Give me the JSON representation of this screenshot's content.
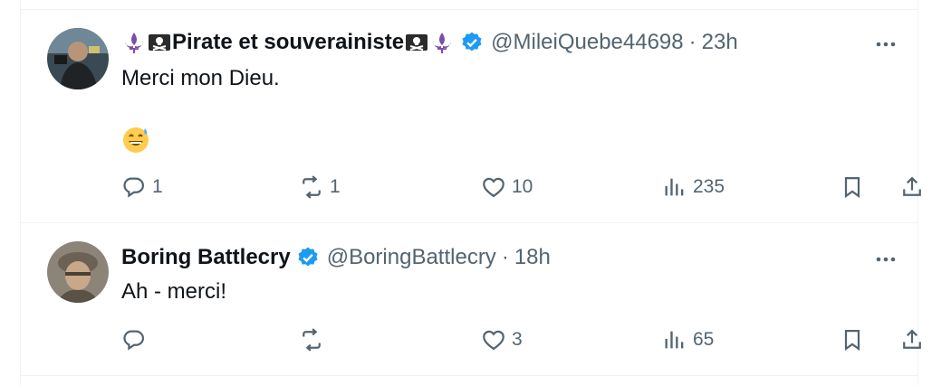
{
  "tweets": [
    {
      "display_name": "Pirate et souverainiste",
      "name_emoji": [
        "fleur-de-lis-emoji",
        "pirate-flag-emoji"
      ],
      "verified": true,
      "handle": "@MileiQuebe44698",
      "separator": "·",
      "time": "23h",
      "text_line1": "Merci mon Dieu.",
      "text_emoji": "grinning-sweat-emoji",
      "actions": {
        "replies": "1",
        "reposts": "1",
        "likes": "10",
        "views": "235"
      }
    },
    {
      "display_name": "Boring Battlecry",
      "verified": true,
      "handle": "@BoringBattlecry",
      "separator": "·",
      "time": "18h",
      "text_line1": "Ah - merci!",
      "actions": {
        "replies": "",
        "reposts": "",
        "likes": "3",
        "views": "65"
      }
    }
  ],
  "colors": {
    "verified": "#1d9bf0",
    "muted": "#536471",
    "text": "#0f1419",
    "border": "#eff3f4",
    "fleur": "#7b4fa8"
  }
}
